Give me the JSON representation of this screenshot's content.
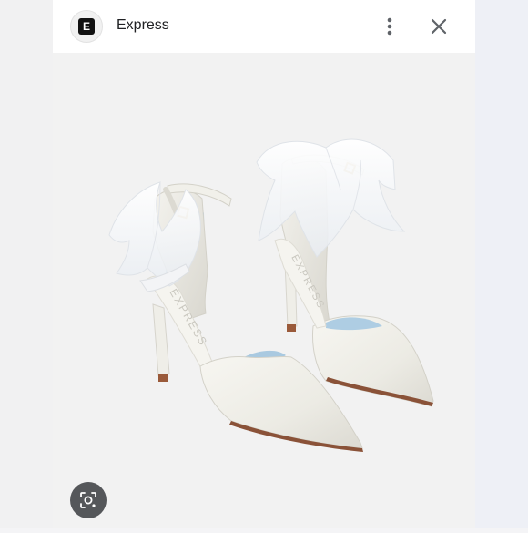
{
  "header": {
    "brand_letter": "E",
    "site_name": "Express",
    "more_icon": "more-vert-icon",
    "close_icon": "close-icon"
  },
  "image": {
    "subject": "white satin pointed-toe pumps with organza bows",
    "insole_text": "EXPRESS"
  },
  "lens": {
    "icon": "visual-search-icon"
  },
  "colors": {
    "header_bg": "#ffffff",
    "panel_bg": "#f2f2f2",
    "lens_bg": "#55575a"
  }
}
